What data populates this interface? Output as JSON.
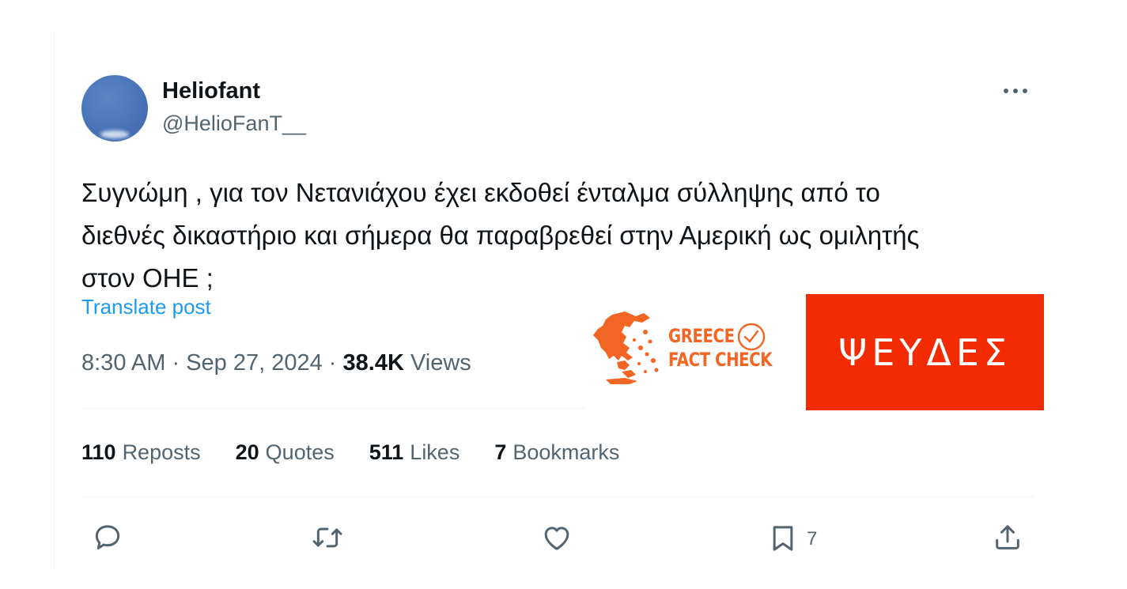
{
  "tweet": {
    "author": {
      "display_name": "Heliofant",
      "handle": "@HelioFanT__"
    },
    "text": "Συγνώμη , για τον Νετανιάχου έχει εκδοθεί ένταλμα σύλληψης από το\nδιεθνές δικαστήριο και σήμερα θα παραβρεθεί στην Αμερική ως ομιλητής\nστον ΟΗΕ ;",
    "translate_label": "Translate post",
    "time": "8:30 AM",
    "date": "Sep 27, 2024",
    "separator": " · ",
    "views_count": "38.4K",
    "views_label": "Views",
    "stats": [
      {
        "count": "110",
        "label": "Reposts"
      },
      {
        "count": "20",
        "label": "Quotes"
      },
      {
        "count": "511",
        "label": "Likes"
      },
      {
        "count": "7",
        "label": "Bookmarks"
      }
    ],
    "bookmark_count": "7"
  },
  "actions": {
    "icons": [
      "reply-icon",
      "repost-icon",
      "like-icon",
      "bookmark-icon",
      "share-icon"
    ]
  },
  "overlay": {
    "logo_line1": "GREECE",
    "logo_line2": "FACT CHECK",
    "verdict": "ΨΕΥΔΕΣ",
    "brand_color": "#f26522",
    "verdict_color": "#f22c00"
  },
  "colors": {
    "text": "#0f1419",
    "secondary": "#536471",
    "link": "#1d9bf0",
    "divider": "#eff3f4"
  }
}
